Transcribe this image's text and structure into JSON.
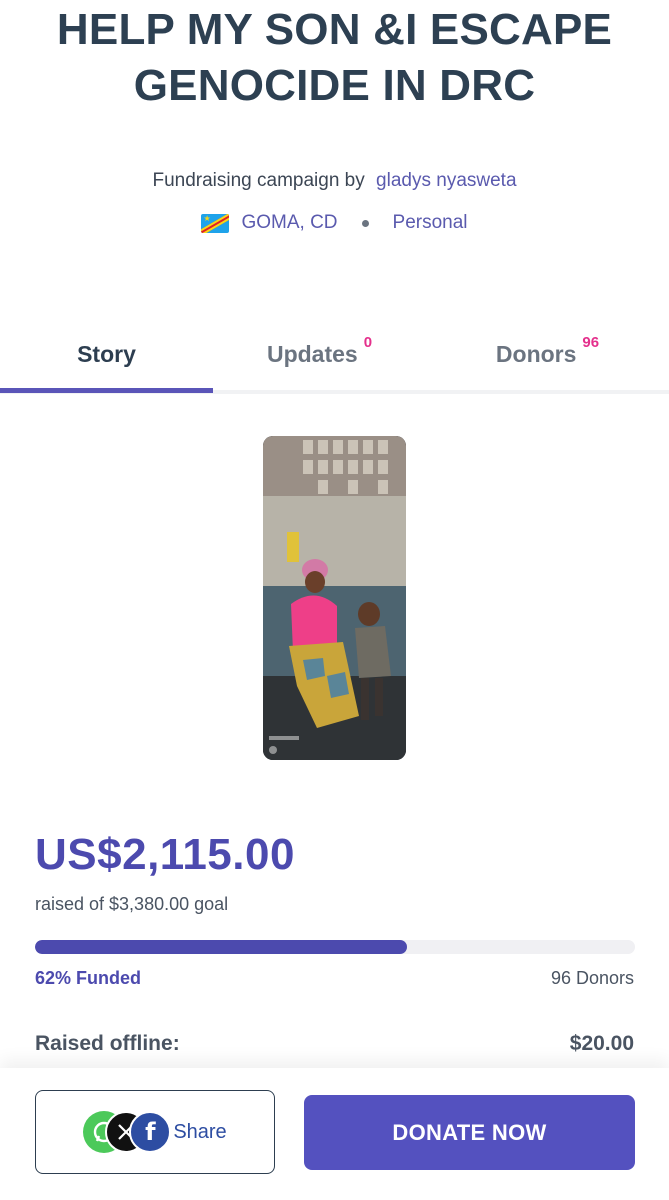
{
  "campaign": {
    "title": "HELP MY SON &I ESCAPE GENOCIDE IN DRC",
    "byline_prefix": "Fundraising campaign by",
    "owner": "gladys nyasweta",
    "location": "GOMA, CD",
    "category": "Personal"
  },
  "tabs": [
    {
      "label": "Story",
      "count": ""
    },
    {
      "label": "Updates",
      "count": "0"
    },
    {
      "label": "Donors",
      "count": "96"
    }
  ],
  "photo": {
    "icon": "campaign-photo"
  },
  "funding": {
    "amount": "US$2,115.00",
    "goal_text": "raised of $3,380.00 goal",
    "progress_fraction": 0.62,
    "funded_text": "62% Funded",
    "donors_text": "96 Donors",
    "offline_label": "Raised offline:",
    "offline_value": "$20.00"
  },
  "actions": {
    "share_label": "Share",
    "donate_label": "DONATE NOW"
  },
  "colors": {
    "accent": "#4c4aae",
    "badge": "#e4308c",
    "title": "#2d4052"
  }
}
